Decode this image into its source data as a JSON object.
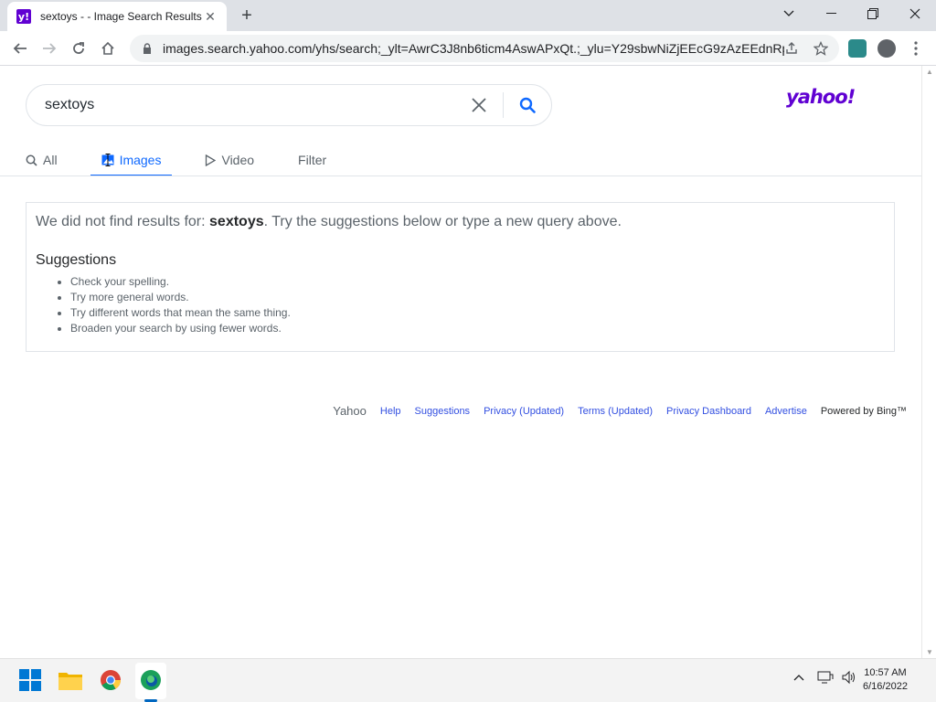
{
  "browser": {
    "tab_title": "sextoys - - Image Search Results",
    "favicon_letter": "y!",
    "tab_close": "✕",
    "new_tab": "+",
    "url": "images.search.yahoo.com/yhs/search;_ylt=AwrC3J8nb6ticm4AswAPxQt.;_ylu=Y29sbwNiZjEEcG9zAzEEdnRpZ..."
  },
  "search": {
    "query": "sextoys"
  },
  "logo": "yahoo!",
  "tabs": [
    {
      "label": "All",
      "icon": "search-icon"
    },
    {
      "label": "Images",
      "icon": "image-icon"
    },
    {
      "label": "Video",
      "icon": "play-icon"
    },
    {
      "label": "Filter",
      "icon": ""
    }
  ],
  "active_tab": "Images",
  "results": {
    "prefix": "We did not find results for: ",
    "query": "sextoys",
    "suffix": ". Try the suggestions below or type a new query above.",
    "suggestions_title": "Suggestions",
    "suggestions": [
      "Check your spelling.",
      "Try more general words.",
      "Try different words that mean the same thing.",
      "Broaden your search by using fewer words."
    ]
  },
  "footer": {
    "brand": "Yahoo",
    "links": [
      "Help",
      "Suggestions",
      "Privacy (Updated)",
      "Terms (Updated)",
      "Privacy Dashboard",
      "Advertise"
    ],
    "powered": "Powered by Bing™"
  },
  "taskbar": {
    "time": "10:57 AM",
    "date": "6/16/2022"
  },
  "colors": {
    "accent": "#0f69ff",
    "yahoo_purple": "#6001d2"
  }
}
